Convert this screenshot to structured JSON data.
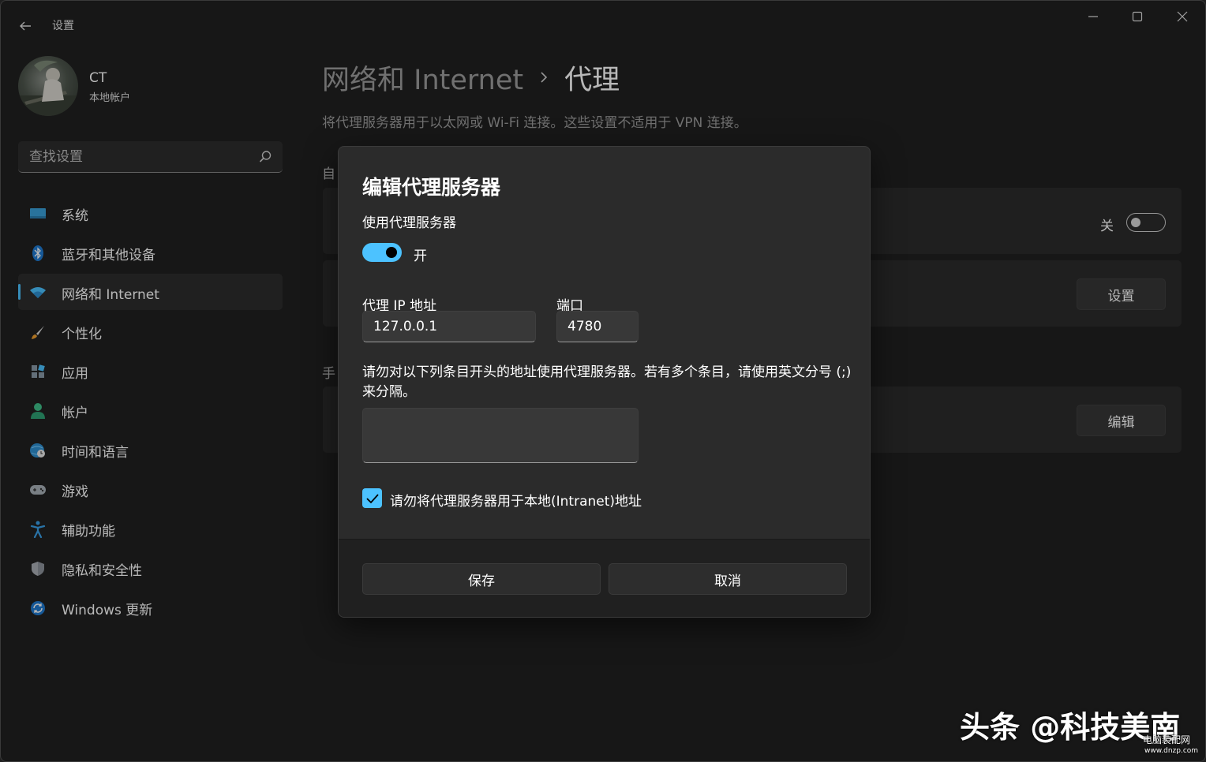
{
  "window": {
    "title": "设置",
    "controls": [
      "minimize-icon",
      "maximize-icon",
      "close-icon"
    ]
  },
  "profile": {
    "name": "CT",
    "account_type": "本地帐户"
  },
  "search": {
    "placeholder": "查找设置"
  },
  "sidebar": {
    "items": [
      {
        "label": "系统",
        "icon": "system-icon",
        "active": false
      },
      {
        "label": "蓝牙和其他设备",
        "icon": "bluetooth-icon",
        "active": false
      },
      {
        "label": "网络和 Internet",
        "icon": "wifi-icon",
        "active": true
      },
      {
        "label": "个性化",
        "icon": "brush-icon",
        "active": false
      },
      {
        "label": "应用",
        "icon": "apps-icon",
        "active": false
      },
      {
        "label": "帐户",
        "icon": "person-icon",
        "active": false
      },
      {
        "label": "时间和语言",
        "icon": "globe-clock-icon",
        "active": false
      },
      {
        "label": "游戏",
        "icon": "gamepad-icon",
        "active": false
      },
      {
        "label": "辅助功能",
        "icon": "accessibility-icon",
        "active": false
      },
      {
        "label": "隐私和安全性",
        "icon": "shield-icon",
        "active": false
      },
      {
        "label": "Windows 更新",
        "icon": "update-icon",
        "active": false
      }
    ]
  },
  "main": {
    "breadcrumb_parent": "网络和 Internet",
    "breadcrumb_current": "代理",
    "description": "将代理服务器用于以太网或 Wi-Fi 连接。这些设置不适用于 VPN 连接。",
    "section_auto_fragment": "自",
    "section_manual_fragment": "手",
    "auto_toggle_state": "关",
    "setup_button": "设置",
    "edit_button": "编辑"
  },
  "dialog": {
    "title": "编辑代理服务器",
    "use_proxy_label": "使用代理服务器",
    "use_proxy_state": "开",
    "ip_label": "代理 IP 地址",
    "ip_value": "127.0.0.1",
    "port_label": "端口",
    "port_value": "4780",
    "exclusion_description": "请勿对以下列条目开头的地址使用代理服务器。若有多个条目，请使用英文分号 (;) 来分隔。",
    "exclusion_value": "",
    "local_checkbox_label": "请勿将代理服务器用于本地(Intranet)地址",
    "local_checkbox_checked": true,
    "save_button": "保存",
    "cancel_button": "取消"
  },
  "watermark": {
    "main": "头条 @科技美南",
    "sub": "电脑装配网",
    "url": "www.dnzp.com"
  },
  "colors": {
    "accent": "#4cc2ff",
    "background": "#202020",
    "card": "#2b2b2b",
    "dialog": "#2b2b2b"
  }
}
